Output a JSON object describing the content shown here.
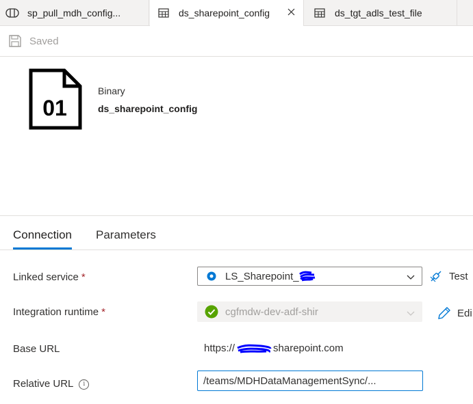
{
  "tabs": [
    {
      "label": "sp_pull_mdh_config...",
      "icon": "pipeline-icon"
    },
    {
      "label": "ds_sharepoint_config",
      "icon": "table-icon",
      "active": true
    },
    {
      "label": "ds_tgt_adls_test_file",
      "icon": "table-icon"
    }
  ],
  "toolbar": {
    "saved_label": "Saved"
  },
  "dataset": {
    "type": "Binary",
    "name": "ds_sharepoint_config",
    "file_icon_text": "01"
  },
  "subtabs": [
    {
      "label": "Connection",
      "active": true
    },
    {
      "label": "Parameters"
    }
  ],
  "form": {
    "linked_service": {
      "label": "Linked service",
      "required_mark": "*",
      "value": "LS_Sharepoint_",
      "action_label": "Test"
    },
    "integration_runtime": {
      "label": "Integration runtime",
      "required_mark": "*",
      "value": "cgfmdw-dev-adf-shir",
      "action_label": "Edi"
    },
    "base_url": {
      "label": "Base URL",
      "prefix": "https://",
      "suffix": "sharepoint.com"
    },
    "relative_url": {
      "label": "Relative URL",
      "info_icon": "info-icon",
      "value": "/teams/MDHDataManagementSync/..."
    }
  },
  "colors": {
    "accent": "#0078d4",
    "required": "#a4262c",
    "success": "#57a300",
    "redaction": "#0000ff"
  }
}
